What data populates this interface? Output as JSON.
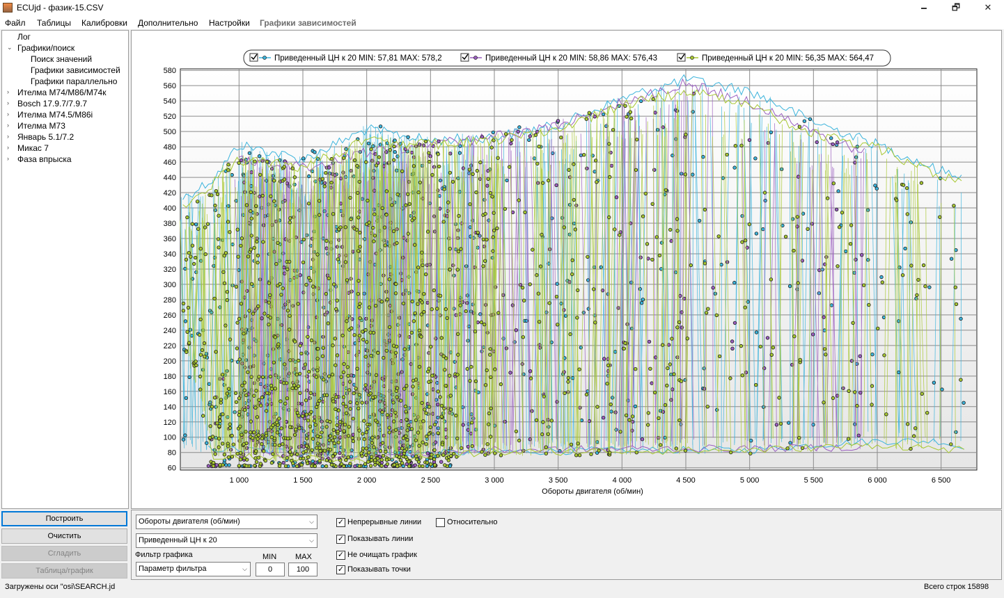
{
  "window": {
    "title": "ECUjd - фазик-15.CSV",
    "minimize": "🗕",
    "maximize": "🗗",
    "close": "✕"
  },
  "menu": [
    "Файл",
    "Таблицы",
    "Калибровки",
    "Дополнительно",
    "Настройки",
    "Графики зависимостей"
  ],
  "tree": [
    {
      "label": "Лог",
      "arrow": "",
      "sub": false
    },
    {
      "label": "Графики/поиск",
      "arrow": "⌄",
      "sub": false
    },
    {
      "label": "Поиск значений",
      "arrow": "",
      "sub": true
    },
    {
      "label": "Графики зависимостей",
      "arrow": "",
      "sub": true
    },
    {
      "label": "Графики параллельно",
      "arrow": "",
      "sub": true
    },
    {
      "label": "Ителма M74/M86/M74к",
      "arrow": "›",
      "sub": false
    },
    {
      "label": "Bosch 17.9.7/7.9.7",
      "arrow": "›",
      "sub": false
    },
    {
      "label": "Ителма M74.5/M86i",
      "arrow": "›",
      "sub": false
    },
    {
      "label": "Ителма M73",
      "arrow": "›",
      "sub": false
    },
    {
      "label": "Январь 5.1/7.2",
      "arrow": "›",
      "sub": false
    },
    {
      "label": "Микас 7",
      "arrow": "›",
      "sub": false
    },
    {
      "label": "Фаза впрыска",
      "arrow": "›",
      "sub": false
    }
  ],
  "buttons": {
    "build": "Построить",
    "clear": "Очистить",
    "smooth": "Сгладить",
    "table_graph": "Таблица/график"
  },
  "controls": {
    "x_axis_select": "Обороты  двигателя (об/мин)",
    "y_axis_select": "Приведенный ЦН к 20",
    "filter_label": "Фильтр графика",
    "filter_select": "Параметр фильтра",
    "min_label": "MIN",
    "max_label": "MAX",
    "min_value": "0",
    "max_value": "100",
    "continuous_lines": "Непрерывные линии",
    "show_lines": "Показывать линии",
    "dont_clear": "Не очищать график",
    "show_points": "Показывать точки",
    "relative": "Относительно",
    "check_mark": "✓"
  },
  "status": {
    "left": "Загружены оси \"osi\\SEARCH.jd",
    "right": "Всего строк 15898"
  },
  "chart_data": {
    "type": "scatter",
    "xlabel": "Обороты  двигателя (об/мин)",
    "ylabel": "",
    "xlim": [
      540,
      6780
    ],
    "ylim": [
      57,
      582
    ],
    "x_ticks": [
      1000,
      1500,
      2000,
      2500,
      3000,
      3500,
      4000,
      4500,
      5000,
      5500,
      6000,
      6500
    ],
    "x_tick_labels": [
      "1 000",
      "1 500",
      "2 000",
      "2 500",
      "3 000",
      "3 500",
      "4 000",
      "4 500",
      "5 000",
      "5 500",
      "6 000",
      "6 500"
    ],
    "y_ticks": [
      60,
      80,
      100,
      120,
      140,
      160,
      180,
      200,
      220,
      240,
      260,
      280,
      300,
      320,
      340,
      360,
      380,
      400,
      420,
      440,
      460,
      480,
      500,
      520,
      540,
      560,
      580
    ],
    "grid": true,
    "legend_position": "top",
    "series": [
      {
        "name": "Приведенный ЦН к 20 MIN: 57,81 MAX: 578,2",
        "color": "#3cb4dc",
        "min": 57.81,
        "max": 578.2,
        "envelope_upper": [
          [
            560,
            420
          ],
          [
            800,
            445
          ],
          [
            1000,
            490
          ],
          [
            1500,
            470
          ],
          [
            2000,
            510
          ],
          [
            2500,
            495
          ],
          [
            3000,
            500
          ],
          [
            3500,
            515
          ],
          [
            4000,
            550
          ],
          [
            4500,
            575
          ],
          [
            5000,
            560
          ],
          [
            5500,
            520
          ],
          [
            6000,
            490
          ],
          [
            6500,
            455
          ],
          [
            6680,
            450
          ]
        ],
        "envelope_lower": [
          [
            800,
            80
          ],
          [
            2000,
            72
          ],
          [
            3000,
            76
          ],
          [
            4000,
            78
          ],
          [
            5000,
            78
          ],
          [
            5500,
            85
          ],
          [
            6000,
            90
          ],
          [
            6500,
            90
          ],
          [
            6680,
            80
          ]
        ]
      },
      {
        "name": "Приведенный ЦН к 20 MIN: 58,86 MAX: 576,43",
        "color": "#9b5fc0",
        "min": 58.86,
        "max": 576.43,
        "envelope_upper": [
          [
            1000,
            470
          ],
          [
            1500,
            460
          ],
          [
            2000,
            480
          ],
          [
            2500,
            490
          ],
          [
            3000,
            500
          ],
          [
            3500,
            515
          ],
          [
            4000,
            545
          ],
          [
            4500,
            570
          ],
          [
            5000,
            545
          ],
          [
            5500,
            505
          ],
          [
            5900,
            480
          ]
        ],
        "envelope_lower": [
          [
            800,
            75
          ],
          [
            2000,
            70
          ],
          [
            3000,
            78
          ],
          [
            4000,
            80
          ],
          [
            5000,
            80
          ],
          [
            5900,
            82
          ]
        ]
      },
      {
        "name": "Приведенный ЦН к 20 MIN: 56,35 MAX: 564,47",
        "color": "#a8c832",
        "min": 56.35,
        "max": 564.47,
        "envelope_upper": [
          [
            560,
            410
          ],
          [
            800,
            440
          ],
          [
            1000,
            470
          ],
          [
            1500,
            460
          ],
          [
            2000,
            495
          ],
          [
            2500,
            490
          ],
          [
            3000,
            495
          ],
          [
            3500,
            510
          ],
          [
            4000,
            540
          ],
          [
            4500,
            560
          ],
          [
            5000,
            540
          ],
          [
            5500,
            505
          ],
          [
            6000,
            485
          ],
          [
            6500,
            450
          ],
          [
            6680,
            445
          ]
        ],
        "envelope_lower": [
          [
            560,
            230
          ],
          [
            800,
            70
          ],
          [
            2000,
            65
          ],
          [
            3000,
            75
          ],
          [
            4000,
            77
          ],
          [
            5000,
            78
          ],
          [
            6000,
            85
          ],
          [
            6680,
            78
          ]
        ]
      }
    ],
    "sample_count": 15898
  }
}
